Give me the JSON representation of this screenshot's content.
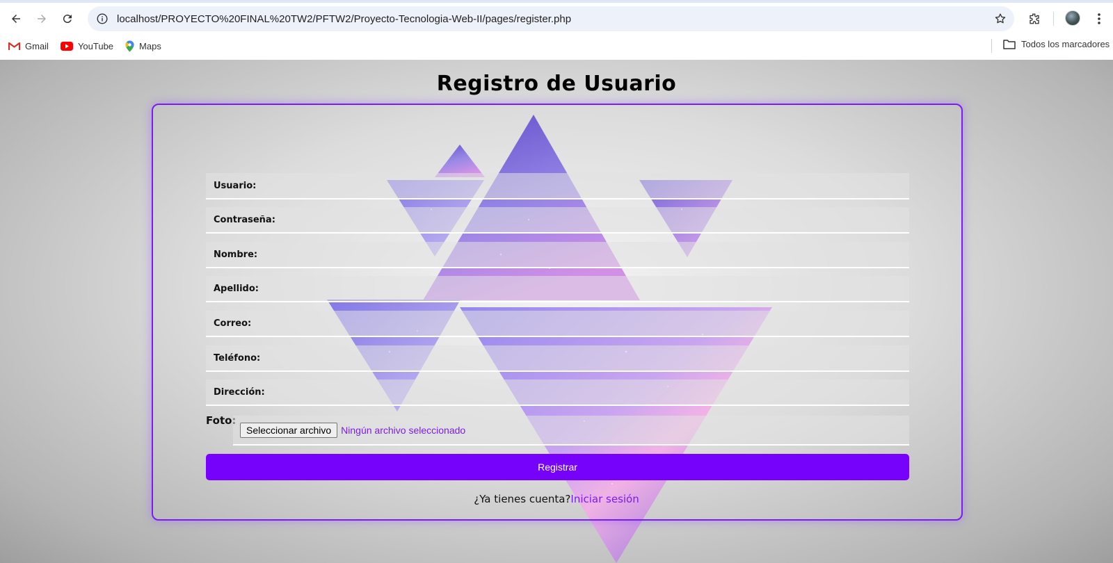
{
  "browser": {
    "url": "localhost/PROYECTO%20FINAL%20TW2/PFTW2/Proyecto-Tecnologia-Web-II/pages/register.php",
    "bookmarks": [
      {
        "label": "Gmail",
        "icon": "gmail-icon"
      },
      {
        "label": "YouTube",
        "icon": "youtube-icon"
      },
      {
        "label": "Maps",
        "icon": "maps-icon"
      }
    ],
    "all_bookmarks": "Todos los marcadores"
  },
  "form": {
    "title": "Registro de Usuario",
    "fields": [
      {
        "label": "Usuario:",
        "value": ""
      },
      {
        "label": "Contraseña:",
        "value": ""
      },
      {
        "label": "Nombre:",
        "value": ""
      },
      {
        "label": "Apellido:",
        "value": ""
      },
      {
        "label": "Correo:",
        "value": ""
      },
      {
        "label": "Teléfono:",
        "value": ""
      },
      {
        "label": "Dirección:",
        "value": ""
      }
    ],
    "photo_label": "Foto:",
    "file_button": "Seleccionar archivo",
    "file_status": "Ningún archivo seleccionado",
    "submit_label": "Registrar",
    "login_prompt": "¿Ya tienes cuenta?",
    "login_link": "Iniciar sesión"
  },
  "colors": {
    "accent": "#7702fb",
    "card_border": "#7a1cf2",
    "link": "#7a1cf2"
  }
}
